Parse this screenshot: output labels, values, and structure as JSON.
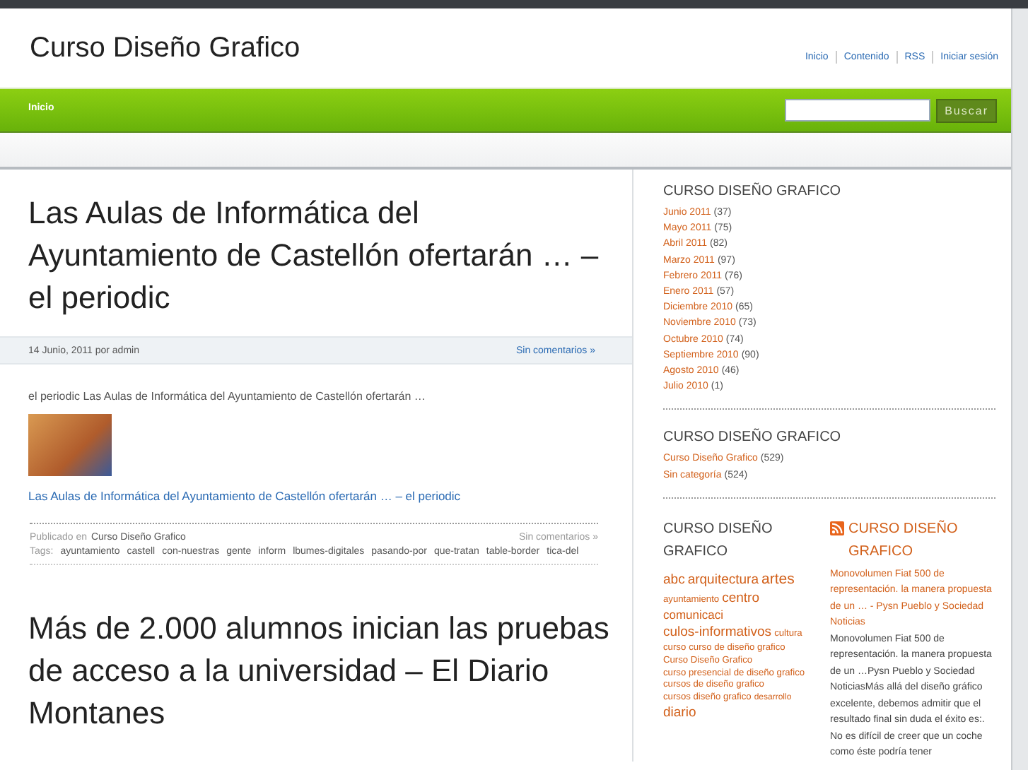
{
  "site_title": "Curso Diseño Grafico",
  "top_links": [
    "Inicio",
    "Contenido",
    "RSS",
    "Iniciar sesión"
  ],
  "nav": [
    {
      "label": "Inicio",
      "selected": true
    }
  ],
  "search": {
    "button": "Buscar"
  },
  "posts": [
    {
      "title": "Las Aulas de Informática del Ayuntamiento de Castellón ofertarán … – el periodic",
      "date": "14 Junio, 2011 por admin",
      "comments": "Sin comentarios »",
      "excerpt": "el periodic Las Aulas de Informática del Ayuntamiento de Castellón ofertarán …",
      "link": "Las Aulas de Informática del Ayuntamiento de Castellón ofertarán … – el periodic",
      "published_label": "Publicado en",
      "category": "Curso Diseño Grafico",
      "footer_comments": "Sin comentarios »",
      "tags_label": "Tags:",
      "tags": [
        "ayuntamiento",
        "castell",
        "con-nuestras",
        "gente",
        "inform",
        "lbumes-digitales",
        "pasando-por",
        "que-tratan",
        "table-border",
        "tica-del"
      ]
    },
    {
      "title": "Más de 2.000 alumnos inician las pruebas de acceso a la universidad – El Diario Montanes"
    }
  ],
  "archives": {
    "title": "CURSO DISEÑO GRAFICO",
    "items": [
      {
        "label": "Junio 2011",
        "count": "(37)"
      },
      {
        "label": "Mayo 2011",
        "count": "(75)"
      },
      {
        "label": "Abril 2011",
        "count": "(82)"
      },
      {
        "label": "Marzo 2011",
        "count": "(97)"
      },
      {
        "label": "Febrero 2011",
        "count": "(76)"
      },
      {
        "label": "Enero 2011",
        "count": "(57)"
      },
      {
        "label": "Diciembre 2010",
        "count": "(65)"
      },
      {
        "label": "Noviembre 2010",
        "count": "(73)"
      },
      {
        "label": "Octubre 2010",
        "count": "(74)"
      },
      {
        "label": "Septiembre 2010",
        "count": "(90)"
      },
      {
        "label": "Agosto 2010",
        "count": "(46)"
      },
      {
        "label": "Julio 2010",
        "count": "(1)"
      }
    ]
  },
  "categories": {
    "title": "CURSO DISEÑO GRAFICO",
    "items": [
      {
        "label": "Curso Diseño Grafico",
        "count": "(529)"
      },
      {
        "label": "Sin categoría",
        "count": "(524)"
      }
    ]
  },
  "tag_cloud": {
    "title": "CURSO DISEÑO GRAFICO",
    "tags": [
      {
        "label": "abc",
        "kind": "large"
      },
      {
        "label": "arquitectura",
        "kind": "large"
      },
      {
        "label": "artes",
        "kind": "xlarge"
      },
      {
        "label": "ayuntamiento",
        "kind": "small"
      },
      {
        "label": "centro",
        "kind": "large"
      },
      {
        "label": "comunicaci",
        "kind": "medium"
      },
      {
        "label": "culos-informativos",
        "kind": "large"
      },
      {
        "label": "cultura",
        "kind": "small"
      },
      {
        "label": "curso",
        "kind": "small"
      },
      {
        "label": "curso de diseño grafico",
        "kind": "small"
      },
      {
        "label": "Curso Diseño Grafico",
        "kind": "small"
      },
      {
        "label": "curso presencial de diseño grafico",
        "kind": "small"
      },
      {
        "label": "cursos de diseño grafico",
        "kind": "small"
      },
      {
        "label": "cursos diseño grafico",
        "kind": "small"
      },
      {
        "label": "desarrollo",
        "kind": "xsmall"
      },
      {
        "label": "diario",
        "kind": "large"
      }
    ]
  },
  "rss": {
    "title": "CURSO DISEÑO GRAFICO",
    "link": "Monovolumen Fiat 500 de representación. la manera propuesta de un … - Pysn Pueblo y Sociedad Noticias",
    "text": "Monovolumen Fiat 500 de representación. la manera propuesta de un …Pysn Pueblo y Sociedad NoticiasMás allá del diseño gráfico excelente, debemos admitir que el resultado final sin duda el éxito es:. No es difícil de creer que un coche como éste podría tener"
  }
}
